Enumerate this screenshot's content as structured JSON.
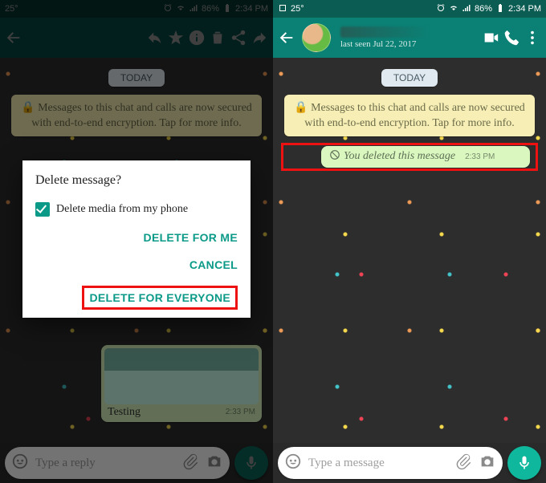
{
  "status": {
    "temp": "25°",
    "battery_pct": "86%",
    "time": "2:34 PM"
  },
  "left": {
    "today_label": "TODAY",
    "encryption_text": "Messages to this chat and calls are now secured with end-to-end encryption. Tap for more info.",
    "media_caption": "Testing",
    "media_time": "2:33 PM",
    "input_placeholder": "Type a reply",
    "dialog": {
      "title": "Delete message?",
      "checkbox_label": "Delete media from my phone",
      "checkbox_checked": true,
      "actions": {
        "delete_for_me": "DELETE FOR ME",
        "cancel": "CANCEL",
        "delete_for_everyone": "DELETE FOR EVERYONE"
      }
    }
  },
  "right": {
    "last_seen": "last seen Jul 22, 2017",
    "today_label": "TODAY",
    "encryption_text": "Messages to this chat and calls are now secured with end-to-end encryption. Tap for more info.",
    "deleted_text": "You deleted this message",
    "deleted_time": "2:33 PM",
    "input_placeholder": "Type a message"
  }
}
